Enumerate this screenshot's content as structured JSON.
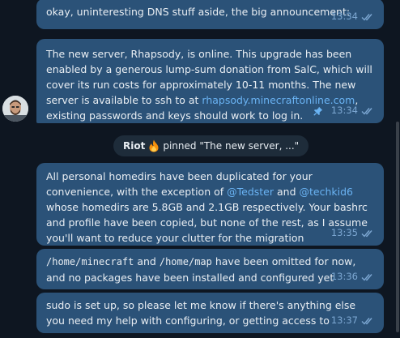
{
  "messages": [
    {
      "text": "okay, uninteresting DNS stuff aside, the big announcement:",
      "time": "13:34",
      "status_icon": "double-check-icon"
    },
    {
      "text_before_link": "The new server, Rhapsody, is online.  This upgrade has been enabled by a generous lump-sum donation from SalC, which will cover its run costs for approximately 10-11 months.  The new server is available to ssh to at ",
      "link": "rhapsody.minecraftonline.com",
      "text_after_link": ", existing passwords and keys should work to log in.",
      "time": "13:34",
      "pinned_icon": "pin-icon",
      "status_icon": "double-check-icon"
    },
    {
      "text_before_mention1": "All personal homedirs have been duplicated for your convenience, with the exception of ",
      "mention1": "@Tedster",
      "text_between": " and ",
      "mention2": "@techkid6",
      "text_after": " whose homedirs are 5.8GB and 2.1GB respectively.  Your bashrc and profile have been copied, but none of the rest, as I assume you'll want to reduce your clutter for the migration",
      "time": "13:35",
      "status_icon": "double-check-icon"
    },
    {
      "code1": "/home/minecraft",
      "text_between": " and ",
      "code2": "/home/map",
      "text_after": " have been omitted for now, and no packages have been installed and configured yet",
      "time": "13:36",
      "status_icon": "double-check-icon"
    },
    {
      "text": "sudo is set up, so please let me know if there's anything else you need my help with configuring, or getting access to",
      "time": "13:37",
      "status_icon": "double-check-icon"
    }
  ],
  "service_message": {
    "actor": "Riot",
    "actor_emoji": "fire-icon",
    "action": " pinned \"The new server, ...\""
  },
  "colors": {
    "background": "#0e1621",
    "bubble": "#2b5278",
    "link": "#6ab3f3",
    "meta": "#7da8d3"
  }
}
